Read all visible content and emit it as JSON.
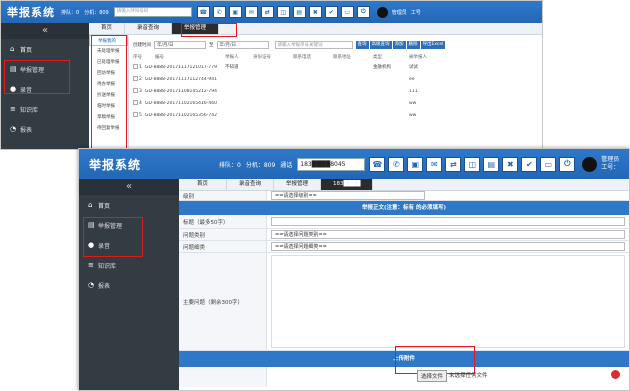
{
  "w1": {
    "logo": "举报系统",
    "queue": "排队：0",
    "ext": "分机：809",
    "search_placeholder": "请输入呼叫号码",
    "user": "管理员",
    "role": "工号",
    "sidebar": [
      "首页",
      "举报管理",
      "录音",
      "知识库",
      "报表"
    ],
    "tabs": [
      "首页",
      "录音查询",
      "举报管理"
    ],
    "subnav": [
      "举报我的",
      "未处理举报",
      "已处理举报",
      "回访举报",
      "待办举报",
      "抄送举报",
      "临时举报",
      "草稿举报",
      "待回复举报"
    ],
    "filter": {
      "label": "创建时间",
      "from": "年/月/日",
      "to_label": "至",
      "to": "年/月/日",
      "keyword_placeholder": "请输入举报单号关键词",
      "buttons": [
        "查询",
        "高级查询",
        "添加",
        "删除",
        "导出Excel"
      ]
    },
    "table_headers": [
      "序号",
      "编号",
      "举报人",
      "身份证号",
      "联系电话",
      "联系地址",
      "类型",
      "被举报人"
    ],
    "rows": [
      {
        "idx": "1",
        "code": "GD-8888-20171117121017-779",
        "name": "不知道",
        "addr": "",
        "type": "金融机构",
        "target": "试试"
      },
      {
        "idx": "2",
        "code": "GD-8888-20171117112744-941",
        "name": "",
        "addr": "",
        "type": "",
        "target": "ee"
      },
      {
        "idx": "3",
        "code": "GD-8888-20171108145212-794",
        "name": "",
        "addr": "",
        "type": "",
        "target": "111"
      },
      {
        "idx": "4",
        "code": "GD-8888-20171102165416-460",
        "name": "",
        "addr": "",
        "type": "",
        "target": "ww"
      },
      {
        "idx": "5",
        "code": "GD-8888-20171102165356-742",
        "name": "",
        "addr": "",
        "type": "",
        "target": "ww"
      }
    ]
  },
  "w2": {
    "logo": "举报系统",
    "queue": "排队：0",
    "ext": "分机：809",
    "call_label": "通话",
    "call_number": "183████8045",
    "user": "管理员",
    "role": "工号：",
    "sidebar": [
      "首页",
      "举报管理",
      "录音",
      "知识库",
      "报表"
    ],
    "tabs": [
      "首页",
      "录音查询",
      "举报管理",
      "183████"
    ],
    "form": {
      "level_label": "级别",
      "level_value": "==请选择级别==",
      "section_title": "举报正文(注意：标有 的必须填写)",
      "title_label": "标题（最多50字）",
      "category_label": "问题类别",
      "category_value": "==请选择问题类别==",
      "detail_label": "问题细类",
      "detail_value": "==请选择问题细类==",
      "main_label": "主要问题（剩余300字）",
      "upload_title": "上传附件",
      "file_button": "选择文件",
      "file_status": "未选择任何文件"
    }
  }
}
